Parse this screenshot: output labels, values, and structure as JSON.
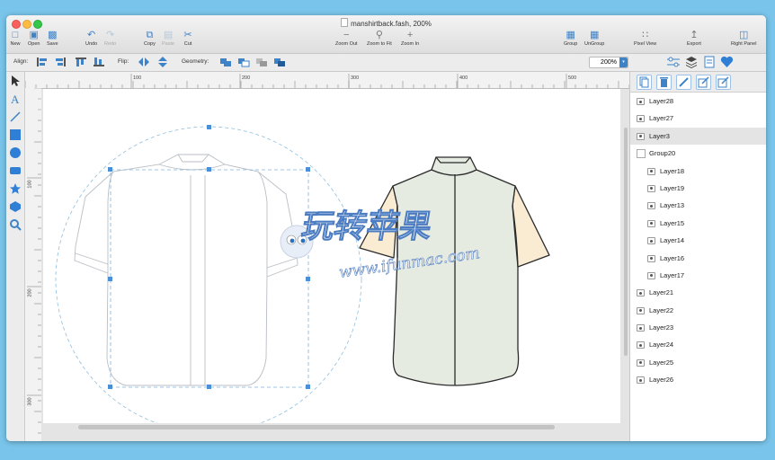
{
  "window": {
    "title": "manshirtback.fash, 200%"
  },
  "toolbar": {
    "new": "New",
    "open": "Open",
    "save": "Save",
    "undo": "Undo",
    "redo": "Redo",
    "copy": "Copy",
    "paste": "Paste",
    "cut": "Cut",
    "zoom_out": "Zoom Out",
    "zoom_fit": "Zoom to Fit",
    "zoom_in": "Zoom In",
    "group": "Group",
    "ungroup": "UnGroup",
    "pixel_view": "Pixel View",
    "export": "Export",
    "right_panel": "Right Panel"
  },
  "toolbar2": {
    "align_label": "Align:",
    "flip_label": "Flip:",
    "geometry_label": "Geometry:",
    "zoom_value": "200%"
  },
  "ruler": {
    "top_ticks": [
      "100",
      "200",
      "300",
      "400",
      "500"
    ],
    "left_ticks": [
      "100",
      "200",
      "300"
    ]
  },
  "watermark": {
    "title": "玩转苹果",
    "url": "www.ifunmac.com"
  },
  "layers": [
    {
      "name": "Layer28",
      "type": "layer",
      "indent": 0,
      "selected": false
    },
    {
      "name": "Layer27",
      "type": "layer",
      "indent": 0,
      "selected": false
    },
    {
      "name": "Layer3",
      "type": "layer",
      "indent": 0,
      "selected": true
    },
    {
      "name": "Group20",
      "type": "group",
      "indent": 0,
      "selected": false
    },
    {
      "name": "Layer18",
      "type": "layer",
      "indent": 1,
      "selected": false
    },
    {
      "name": "Layer19",
      "type": "layer",
      "indent": 1,
      "selected": false
    },
    {
      "name": "Layer13",
      "type": "layer",
      "indent": 1,
      "selected": false
    },
    {
      "name": "Layer15",
      "type": "layer",
      "indent": 1,
      "selected": false
    },
    {
      "name": "Layer14",
      "type": "layer",
      "indent": 1,
      "selected": false
    },
    {
      "name": "Layer16",
      "type": "layer",
      "indent": 1,
      "selected": false
    },
    {
      "name": "Layer17",
      "type": "layer",
      "indent": 1,
      "selected": false
    },
    {
      "name": "Layer21",
      "type": "layer",
      "indent": 0,
      "selected": false
    },
    {
      "name": "Layer22",
      "type": "layer",
      "indent": 0,
      "selected": false
    },
    {
      "name": "Layer23",
      "type": "layer",
      "indent": 0,
      "selected": false
    },
    {
      "name": "Layer24",
      "type": "layer",
      "indent": 0,
      "selected": false
    },
    {
      "name": "Layer25",
      "type": "layer",
      "indent": 0,
      "selected": false
    },
    {
      "name": "Layer26",
      "type": "layer",
      "indent": 0,
      "selected": false
    }
  ],
  "colors": {
    "accent": "#3e83c8",
    "selection": "#4a90d9",
    "shirt_body": "#e6ebe2",
    "shirt_sleeve": "#f9ecd3",
    "desktop": "#79c4ea"
  }
}
